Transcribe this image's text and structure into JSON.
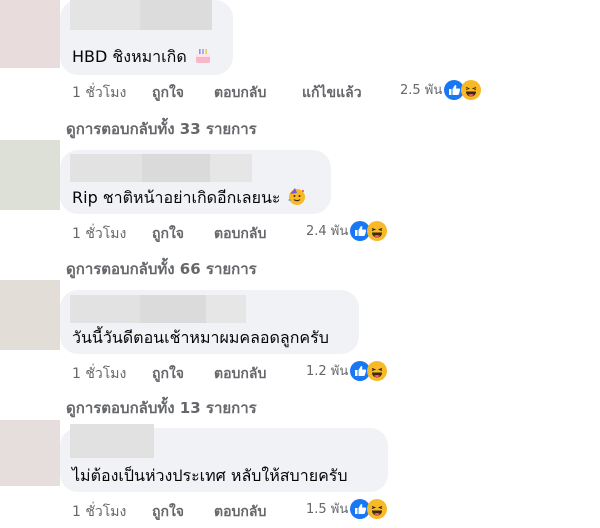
{
  "comments": [
    {
      "text": "HBD ชิงหมาเกิด",
      "time": "1 ชั่วโมง",
      "like": "ถูกใจ",
      "reply": "ตอบกลับ",
      "edited": "แก้ไขแล้ว",
      "reactions": "2.5 พัน",
      "replies": "ดูการตอบกลับทั้ง 33 รายการ",
      "emoji": "cake-icon"
    },
    {
      "text": "Rip ชาติหน้าอย่าเกิดอีกเลยนะ",
      "time": "1 ชั่วโมง",
      "like": "ถูกใจ",
      "reply": "ตอบกลับ",
      "reactions": "2.4 พัน",
      "replies": "ดูการตอบกลับทั้ง 66 รายการ",
      "emoji": "party-face-icon"
    },
    {
      "text": "วันนี้วันดีตอนเช้าหมาผมคลอดลูกครับ",
      "time": "1 ชั่วโมง",
      "like": "ถูกใจ",
      "reply": "ตอบกลับ",
      "reactions": "1.2 พัน",
      "replies": "ดูการตอบกลับทั้ง 13 รายการ"
    },
    {
      "text": "ไม่ต้องเป็นห่วงประเทศ หลับให้สบายครับ",
      "time": "1 ชั่วโมง",
      "like": "ถูกใจ",
      "reply": "ตอบกลับ",
      "reactions": "1.5 พัน"
    }
  ],
  "colors": {
    "bubble": "#f0f2f5",
    "meta": "#65676b",
    "like_blue": "#1877f2",
    "haha_yellow": "#f7b928"
  },
  "icons": [
    "like-reaction-icon",
    "haha-reaction-icon"
  ]
}
